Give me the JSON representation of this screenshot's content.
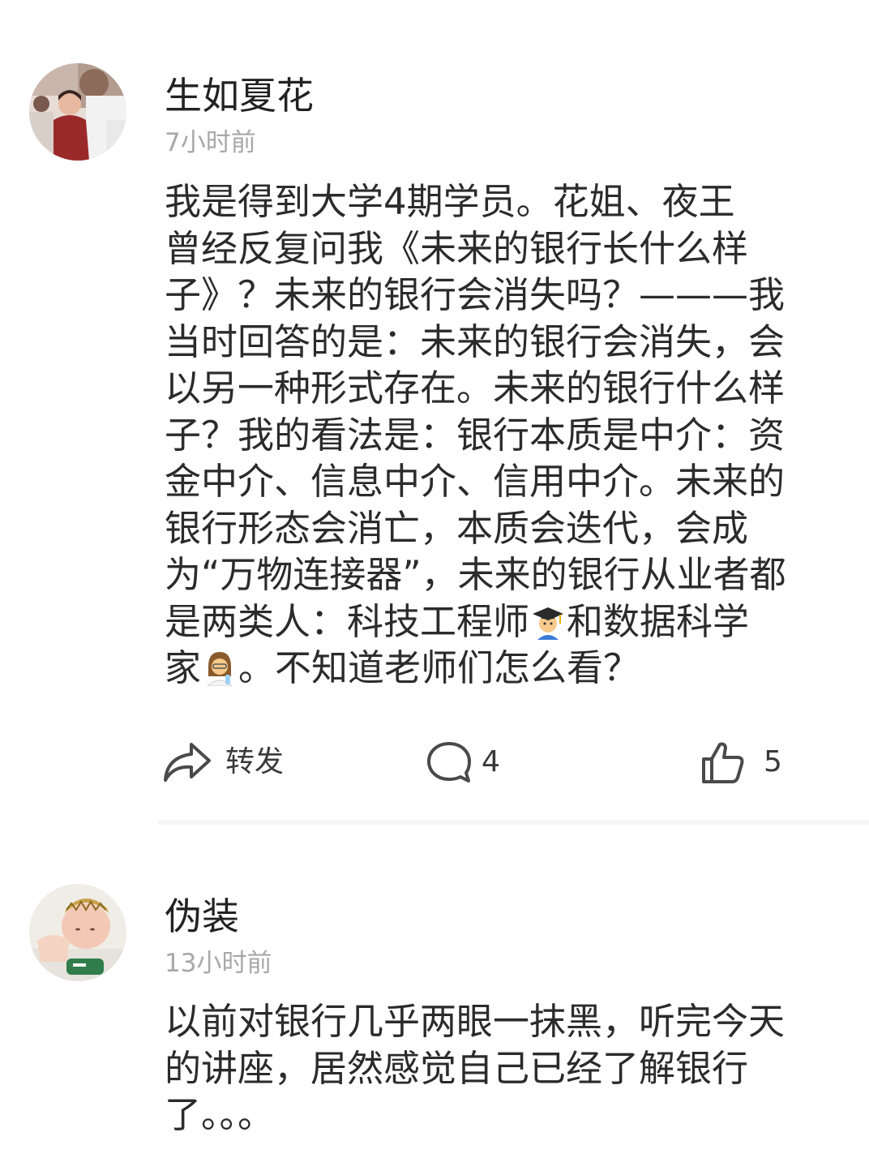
{
  "posts": [
    {
      "author": "生如夏花",
      "time": "7小时前",
      "avatar_icon": "avatar-photo-person",
      "content_lines": [
        "我是得到大学4期学员。花姐、夜王",
        "曾经反复问我《未来的银行长什么样",
        "子》？未来的银行会消失吗？———我",
        "当时回答的是：未来的银行会消失，会",
        "以另一种形式存在。未来的银行什么样",
        "子？我的看法是：银行本质是中介：资",
        "金中介、信息中介、信用中介。未来的",
        "银行形态会消亡，本质会迭代，会成",
        "为“万物连接器”，未来的银行从业者都",
        "是两类人：科技工程师",
        "和数据科学",
        "家",
        "。不知道老师们怎么看？"
      ],
      "emojis": [
        "man-student-emoji",
        "woman-scientist-emoji"
      ],
      "actions": {
        "share_label": "转发",
        "comment_count": "4",
        "like_count": "5"
      }
    },
    {
      "author": "伪装",
      "time": "13小时前",
      "avatar_icon": "avatar-photo-baby",
      "content_lines": [
        "以前对银行几乎两眼一抹黑，听完今天",
        "的讲座，居然感觉自己已经了解银行",
        "了。。。"
      ]
    }
  ],
  "colors": {
    "text": "#2b2b2b",
    "name": "#222222",
    "timestamp": "#a8a8a8",
    "icon": "#4a4a4a",
    "divider": "#f5f5f5"
  }
}
